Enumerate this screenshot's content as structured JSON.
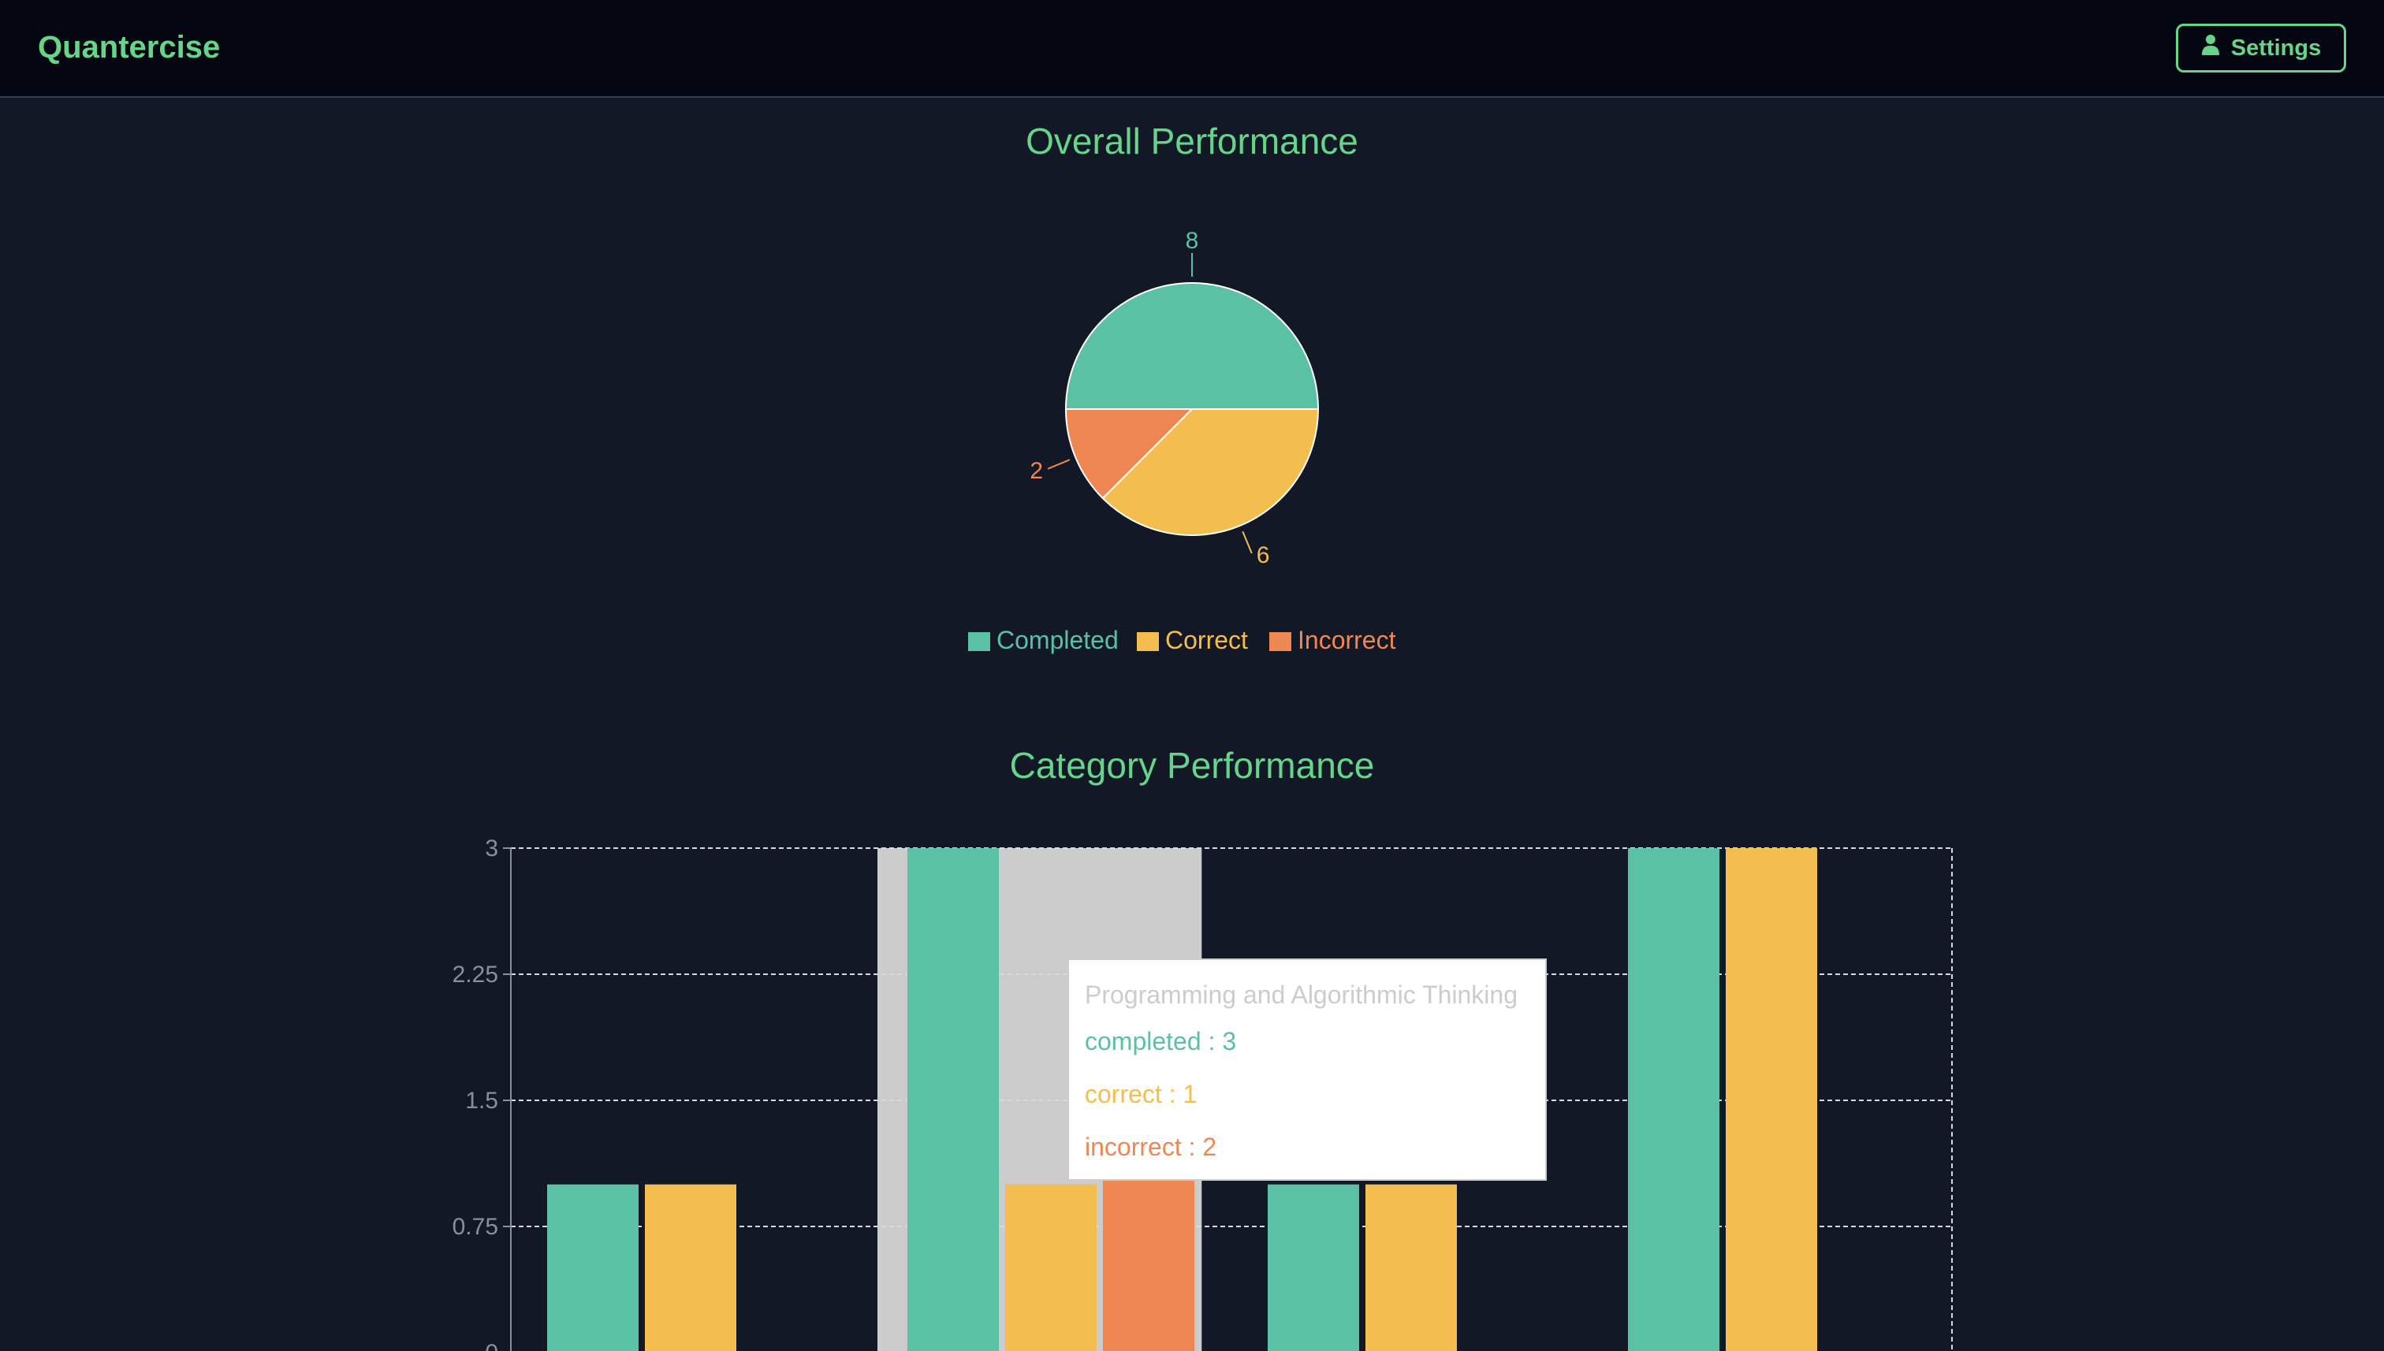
{
  "header": {
    "brand": "Quantercise",
    "settings_label": "Settings",
    "settings_icon": "user-icon"
  },
  "colors": {
    "accent": "#66d58a",
    "completed": "#5ac1a4",
    "correct": "#f4be4e",
    "incorrect": "#ef8753",
    "background": "#131826",
    "header_bg": "#040712",
    "tooltip_cursor": "#cccccc"
  },
  "overall": {
    "title": "Overall Performance"
  },
  "category": {
    "title": "Category Performance"
  },
  "tooltip": {
    "title": "Programming and Algorithmic Thinking",
    "completed_text": "completed : 3",
    "correct_text": "correct : 1",
    "incorrect_text": "incorrect : 2"
  },
  "chart_data": [
    {
      "type": "pie",
      "title": "Overall Performance",
      "categories": [
        "Completed",
        "Correct",
        "Incorrect"
      ],
      "values": [
        8,
        6,
        2
      ],
      "legend": "bottom"
    },
    {
      "type": "bar",
      "title": "Category Performance",
      "series": [
        {
          "name": "completed",
          "values": [
            1,
            3,
            1,
            3
          ]
        },
        {
          "name": "correct",
          "values": [
            1,
            1,
            1,
            3
          ]
        },
        {
          "name": "incorrect",
          "values": [
            0,
            2,
            0,
            0
          ]
        }
      ],
      "y_ticks": [
        "3",
        "2.25",
        "1.5",
        "0.75",
        "0"
      ],
      "ylim": [
        0,
        3
      ],
      "grid": true,
      "highlighted_category_index": 1
    }
  ]
}
